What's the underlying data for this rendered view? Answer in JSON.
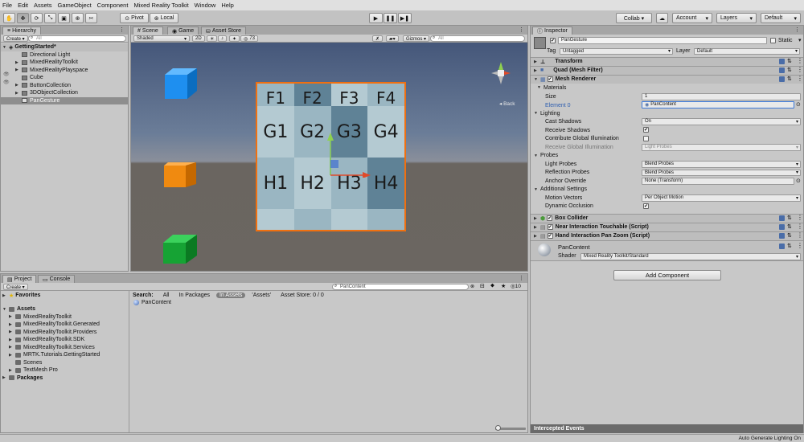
{
  "menubar": [
    "File",
    "Edit",
    "Assets",
    "GameObject",
    "Component",
    "Mixed Reality Toolkit",
    "Window",
    "Help"
  ],
  "toolbar": {
    "pivot": "Pivot",
    "local": "Local",
    "collab": "Collab ▾",
    "account": "Account",
    "layers": "Layers",
    "layout": "Default"
  },
  "hierarchy": {
    "tab": "Hierarchy",
    "create": "Create ▾",
    "search_placeholder": "All",
    "scene": "GettingStarted*",
    "items": [
      "Directional Light",
      "MixedRealityToolkit",
      "MixedRealityPlayspace",
      "Cube",
      "ButtonCollection",
      "3DObjectCollection",
      "PanGesture"
    ]
  },
  "scene": {
    "tabs": [
      "Scene",
      "Game",
      "Asset Store"
    ],
    "shading": "Shaded",
    "mode_2d": "2D",
    "fx_count": "73",
    "gizmos": "Gizmos ▾",
    "search_placeholder": "All",
    "back_label": "◂ Back",
    "grid": {
      "top": [
        "F1",
        "F2",
        "F3",
        "F4"
      ],
      "mid": [
        "G1",
        "G2",
        "G3",
        "G4"
      ],
      "bot": [
        "H1",
        "H2",
        "H3",
        "H4"
      ]
    },
    "colors": {
      "blue_cube": "#1e8ff0",
      "orange_cube": "#f08a10",
      "green_cube": "#16a334",
      "selection": "#f07010"
    }
  },
  "inspector": {
    "tab": "Inspector",
    "object_name": "PanGesture",
    "static_label": "Static",
    "tag_label": "Tag",
    "tag_value": "Untagged",
    "layer_label": "Layer",
    "layer_value": "Default",
    "components": {
      "transform": "Transform",
      "mesh_filter": "Quad (Mesh Filter)",
      "mesh_renderer": "Mesh Renderer",
      "box_collider": "Box Collider",
      "near_touch": "Near Interaction Touchable (Script)",
      "pan_zoom": "Hand Interaction Pan Zoom (Script)"
    },
    "materials": {
      "header": "Materials",
      "size_label": "Size",
      "size_value": "1",
      "element_label": "Element 0",
      "element_value": "PanContent"
    },
    "lighting": {
      "header": "Lighting",
      "cast_shadows_label": "Cast Shadows",
      "cast_shadows_value": "On",
      "receive_shadows_label": "Receive Shadows",
      "contribute_gi_label": "Contribute Global Illumination",
      "receive_gi_label": "Receive Global Illumination",
      "receive_gi_value": "Light Probes"
    },
    "probes": {
      "header": "Probes",
      "light_probes_label": "Light Probes",
      "light_probes_value": "Blend Probes",
      "reflection_label": "Reflection Probes",
      "reflection_value": "Blend Probes",
      "anchor_label": "Anchor Override",
      "anchor_value": "None (Transform)"
    },
    "additional": {
      "header": "Additional Settings",
      "motion_label": "Motion Vectors",
      "motion_value": "Per Object Motion",
      "occlusion_label": "Dynamic Occlusion"
    },
    "material": {
      "name": "PanContent",
      "shader_label": "Shader",
      "shader_value": "Mixed Reality Toolkit/Standard"
    },
    "add_component": "Add Component",
    "intercepted": "Intercepted Events"
  },
  "project": {
    "tabs": [
      "Project",
      "Console"
    ],
    "create": "Create ▾",
    "search_value": "PanContent",
    "filter_count": "10",
    "search_label": "Search:",
    "scope_all": "All",
    "scope_packages": "In Packages",
    "scope_assets": "In Assets",
    "scope_folder": "'Assets'",
    "asset_store": "Asset Store: 0 / 0",
    "result": "PanContent",
    "favorites": "Favorites",
    "assets": "Assets",
    "folders": [
      "MixedRealityToolkit",
      "MixedRealityToolkit.Generated",
      "MixedRealityToolkit.Providers",
      "MixedRealityToolkit.SDK",
      "MixedRealityToolkit.Services",
      "MRTK.Tutorials.GettingStarted",
      "Scenes",
      "TextMesh Pro"
    ],
    "packages": "Packages"
  },
  "status": "Auto Generate Lighting On"
}
